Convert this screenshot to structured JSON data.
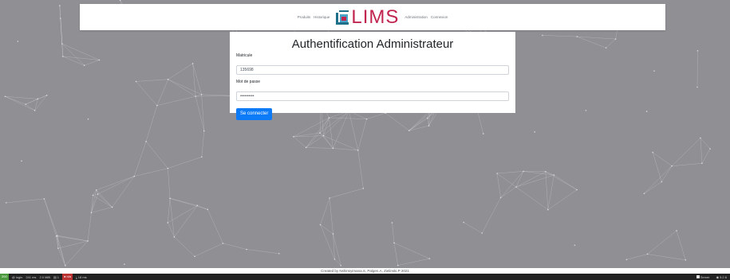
{
  "nav": {
    "links_left": [
      "Produits",
      "Historique"
    ],
    "logo_text": "LIMS",
    "links_right": [
      "Administration",
      "Connexion"
    ]
  },
  "form": {
    "title": "Authentification Administrateur",
    "matricule_label": "Matricule",
    "matricule_value": "135698",
    "password_label": "Mot de passe",
    "password_value": "••••••••••",
    "submit_label": "Se connecter"
  },
  "footer": {
    "text": "Created by Nshimiyimana.S, Palgen.A, Zielinski.P 2021"
  },
  "debug_toolbar": {
    "status": "200",
    "route": "@ login",
    "time": "241 ms",
    "memory": "2.0 MiB",
    "db_count": "1",
    "user": "n/a",
    "ajax": "18 ms",
    "server_label": "Server",
    "version": "5.2.6"
  },
  "colors": {
    "button": "#0d7bf8",
    "logo": "#c0244f",
    "background": "#8f8f94"
  }
}
